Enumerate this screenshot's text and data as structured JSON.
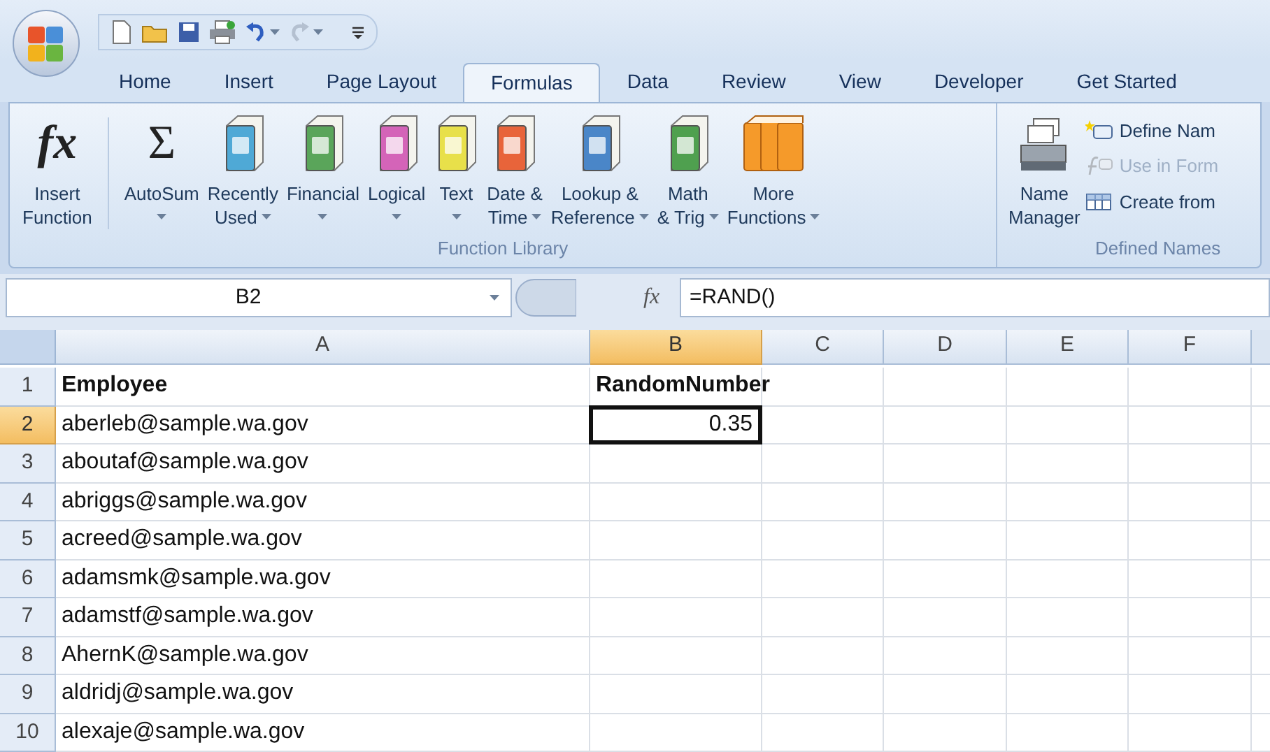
{
  "quick_access": {
    "undo_enabled": true,
    "redo_enabled": false
  },
  "tabs": [
    {
      "label": "Home",
      "selected": false
    },
    {
      "label": "Insert",
      "selected": false
    },
    {
      "label": "Page Layout",
      "selected": false
    },
    {
      "label": "Formulas",
      "selected": true
    },
    {
      "label": "Data",
      "selected": false
    },
    {
      "label": "Review",
      "selected": false
    },
    {
      "label": "View",
      "selected": false
    },
    {
      "label": "Developer",
      "selected": false
    },
    {
      "label": "Get Started",
      "selected": false
    }
  ],
  "function_library": {
    "title": "Function Library",
    "buttons": [
      {
        "kind": "glyph",
        "glyph": "fx",
        "label_lines": [
          "Insert",
          "Function"
        ],
        "has_menu": false
      },
      {
        "kind": "glyph",
        "glyph": "Σ",
        "label_lines": [
          "AutoSum"
        ],
        "has_menu": true
      },
      {
        "kind": "book",
        "color": "#4fa9d6",
        "label_lines": [
          "Recently",
          "Used"
        ],
        "has_menu": true
      },
      {
        "kind": "book",
        "color": "#5aa55a",
        "label_lines": [
          "Financial"
        ],
        "has_menu": true
      },
      {
        "kind": "book",
        "color": "#d464b8",
        "label_lines": [
          "Logical"
        ],
        "has_menu": true
      },
      {
        "kind": "book",
        "color": "#e8e04a",
        "label_lines": [
          "Text"
        ],
        "has_menu": true
      },
      {
        "kind": "book",
        "color": "#e8643a",
        "label_lines": [
          "Date &",
          "Time"
        ],
        "has_menu": true
      },
      {
        "kind": "book",
        "color": "#4a86c8",
        "label_lines": [
          "Lookup &",
          "Reference"
        ],
        "has_menu": true
      },
      {
        "kind": "book",
        "color": "#4fa04f",
        "label_lines": [
          "Math",
          "& Trig"
        ],
        "has_menu": true
      },
      {
        "kind": "books",
        "color": "#f59a2a",
        "label_lines": [
          "More",
          "Functions"
        ],
        "has_menu": true
      }
    ]
  },
  "defined_names": {
    "title": "Defined Names",
    "manager": {
      "label_lines": [
        "Name",
        "Manager"
      ]
    },
    "items": [
      {
        "kind": "define",
        "label": "Define Nam",
        "disabled": false
      },
      {
        "kind": "use",
        "label": "Use in Form",
        "disabled": true
      },
      {
        "kind": "create",
        "label": "Create from",
        "disabled": false
      }
    ]
  },
  "formula_bar": {
    "name_box": "B2",
    "fx": "fx",
    "formula": "=RAND()"
  },
  "sheet": {
    "columns": [
      {
        "label": "A",
        "selected": false
      },
      {
        "label": "B",
        "selected": true
      },
      {
        "label": "C",
        "selected": false
      },
      {
        "label": "D",
        "selected": false
      },
      {
        "label": "E",
        "selected": false
      },
      {
        "label": "F",
        "selected": false
      }
    ],
    "rows": [
      {
        "number": "1",
        "selected": false,
        "header": true,
        "cells": [
          "Employee",
          "RandomNumber"
        ]
      },
      {
        "number": "2",
        "selected": true,
        "header": false,
        "cells": [
          "aberleb@sample.wa.gov",
          "0.35"
        ],
        "active_column": {
          "selected": true
        }
      },
      {
        "number": "3",
        "selected": false,
        "header": false,
        "cells": [
          "aboutaf@sample.wa.gov"
        ]
      },
      {
        "number": "4",
        "selected": false,
        "header": false,
        "cells": [
          "abriggs@sample.wa.gov"
        ]
      },
      {
        "number": "5",
        "selected": false,
        "header": false,
        "cells": [
          "acreed@sample.wa.gov"
        ]
      },
      {
        "number": "6",
        "selected": false,
        "header": false,
        "cells": [
          "adamsmk@sample.wa.gov"
        ]
      },
      {
        "number": "7",
        "selected": false,
        "header": false,
        "cells": [
          "adamstf@sample.wa.gov"
        ]
      },
      {
        "number": "8",
        "selected": false,
        "header": false,
        "cells": [
          "AhernK@sample.wa.gov"
        ]
      },
      {
        "number": "9",
        "selected": false,
        "header": false,
        "cells": [
          "aldridj@sample.wa.gov"
        ]
      },
      {
        "number": "10",
        "selected": false,
        "header": false,
        "cells": [
          "alexaje@sample.wa.gov"
        ]
      }
    ]
  }
}
